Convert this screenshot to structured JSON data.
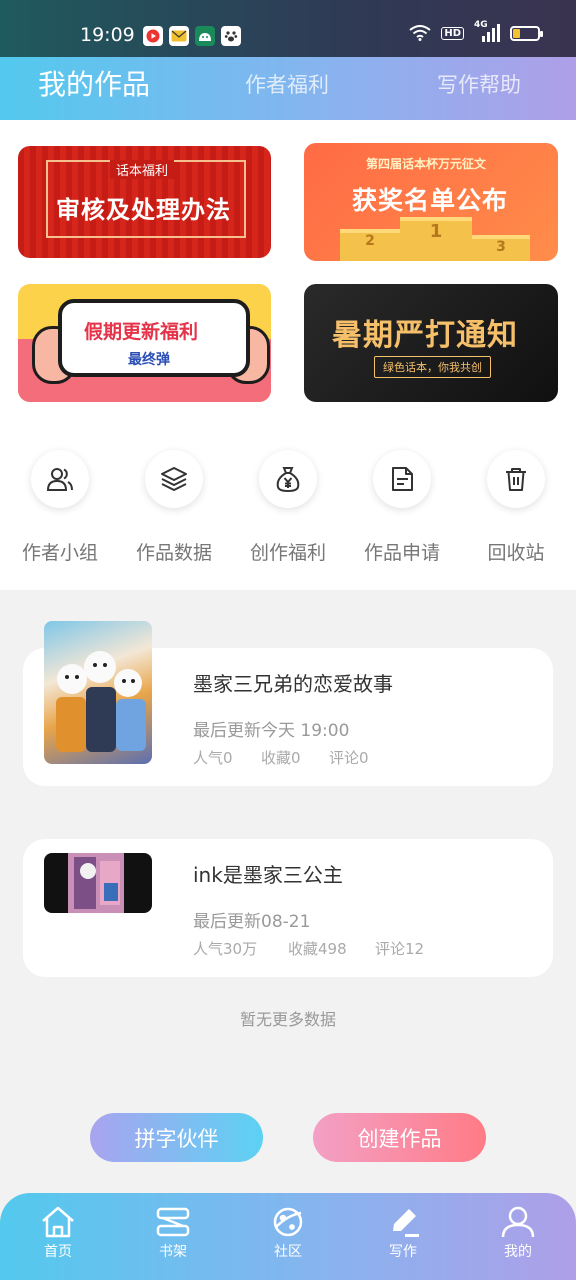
{
  "status_bar": {
    "time": "19:09",
    "network": "4G",
    "hd_label": "HD",
    "battery_level": 0.3,
    "left_app_icons": [
      "video-app-icon",
      "mail-app-icon",
      "android-app-icon",
      "paw-app-icon"
    ]
  },
  "top_tabs": [
    {
      "label": "我的作品",
      "active": true
    },
    {
      "label": "作者福利",
      "active": false
    },
    {
      "label": "写作帮助",
      "active": false
    }
  ],
  "banners": {
    "b1": {
      "tag": "话本福利",
      "title": "审核及处理办法"
    },
    "b2": {
      "subtitle": "第四届话本杯万元征文",
      "title": "获奖名单公布",
      "podium": [
        "2",
        "1",
        "3"
      ]
    },
    "b3": {
      "title": "假期更新福利",
      "subtitle": "最终弹"
    },
    "b4": {
      "title": "暑期严打通知",
      "subtitle": "绿色话本，你我共创"
    }
  },
  "quick_actions": [
    {
      "label": "作者小组",
      "icon": "users-icon"
    },
    {
      "label": "作品数据",
      "icon": "layers-icon"
    },
    {
      "label": "创作福利",
      "icon": "money-bag-icon"
    },
    {
      "label": "作品申请",
      "icon": "document-icon"
    },
    {
      "label": "回收站",
      "icon": "trash-icon"
    }
  ],
  "works": [
    {
      "title": "墨家三兄弟的恋爱故事",
      "updated": "最后更新今天 19:00",
      "popularity": "人气0",
      "favorites": "收藏0",
      "comments": "评论0"
    },
    {
      "title": "ink是墨家三公主",
      "updated": "最后更新08-21",
      "popularity": "人气30万",
      "favorites": "收藏498",
      "comments": "评论12"
    }
  ],
  "no_more_text": "暂无更多数据",
  "actions": {
    "partner": "拼字伙伴",
    "create": "创建作品"
  },
  "bottom_nav": [
    {
      "label": "首页",
      "icon": "home-icon"
    },
    {
      "label": "书架",
      "icon": "bookshelf-icon"
    },
    {
      "label": "社区",
      "icon": "planet-icon"
    },
    {
      "label": "写作",
      "icon": "pen-icon"
    },
    {
      "label": "我的",
      "icon": "person-icon"
    }
  ],
  "colors": {
    "header_gradient_start": "#53c9ee",
    "header_gradient_end": "#ae9fe8",
    "create_button": "#ff7b86",
    "partner_button": "#5cd2f3"
  }
}
